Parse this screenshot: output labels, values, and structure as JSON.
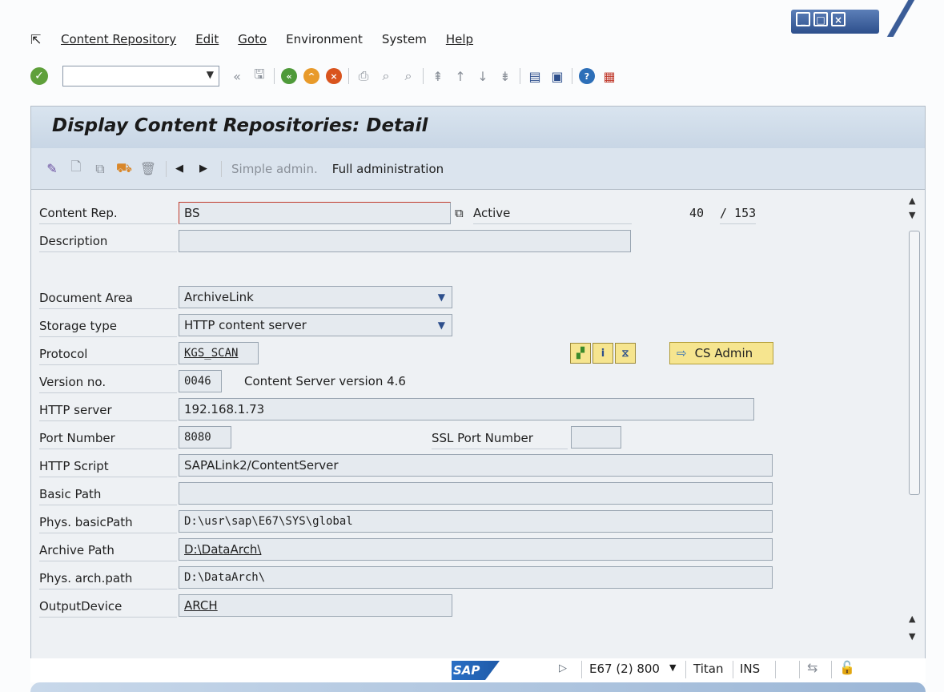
{
  "menu": {
    "items": [
      {
        "label": "Content Repository"
      },
      {
        "label": "Edit"
      },
      {
        "label": "Goto"
      },
      {
        "label": "Environment"
      },
      {
        "label": "System"
      },
      {
        "label": "Help"
      }
    ]
  },
  "toolbar": {
    "command_field_value": "",
    "expand_label": "«"
  },
  "page": {
    "title": "Display Content Repositories: Detail"
  },
  "app_toolbar": {
    "simple_admin": "Simple admin.",
    "full_admin": "Full administration"
  },
  "form": {
    "content_rep": {
      "label": "Content Rep.",
      "value": "BS"
    },
    "status": "Active",
    "record_current": "40",
    "record_total": "/ 153",
    "description": {
      "label": "Description",
      "value": ""
    },
    "document_area": {
      "label": "Document Area",
      "value": "ArchiveLink"
    },
    "storage_type": {
      "label": "Storage type",
      "value": "HTTP content server"
    },
    "protocol": {
      "label": "Protocol",
      "value": "KGS_SCAN"
    },
    "version_no": {
      "label": "Version no.",
      "value": "0046",
      "text": "Content Server version 4.6"
    },
    "http_server": {
      "label": "HTTP server",
      "value": "192.168.1.73"
    },
    "port_number": {
      "label": "Port Number",
      "value": "8080"
    },
    "ssl_port": {
      "label": "SSL Port Number",
      "value": ""
    },
    "http_script": {
      "label": "HTTP Script",
      "value": "SAPALink2/ContentServer"
    },
    "basic_path": {
      "label": "Basic Path",
      "value": ""
    },
    "phys_basic_path": {
      "label": "Phys. basicPath",
      "value": "D:\\usr\\sap\\E67\\SYS\\global"
    },
    "archive_path": {
      "label": "Archive Path",
      "value": "D:\\DataArch\\"
    },
    "phys_arch_path": {
      "label": "Phys. arch.path",
      "value": "D:\\DataArch\\"
    },
    "output_device": {
      "label": "OutputDevice",
      "value": "ARCH"
    },
    "cs_admin_button": "CS Admin"
  },
  "status_bar": {
    "logo": "SAP",
    "system": "E67 (2) 800",
    "server": "Titan",
    "mode": "INS"
  },
  "colors": {
    "title_bg": "#c8d6e5",
    "field_bg": "#e5eaef",
    "button_yellow": "#f6e58f",
    "accent_blue": "#2d4f8c"
  }
}
